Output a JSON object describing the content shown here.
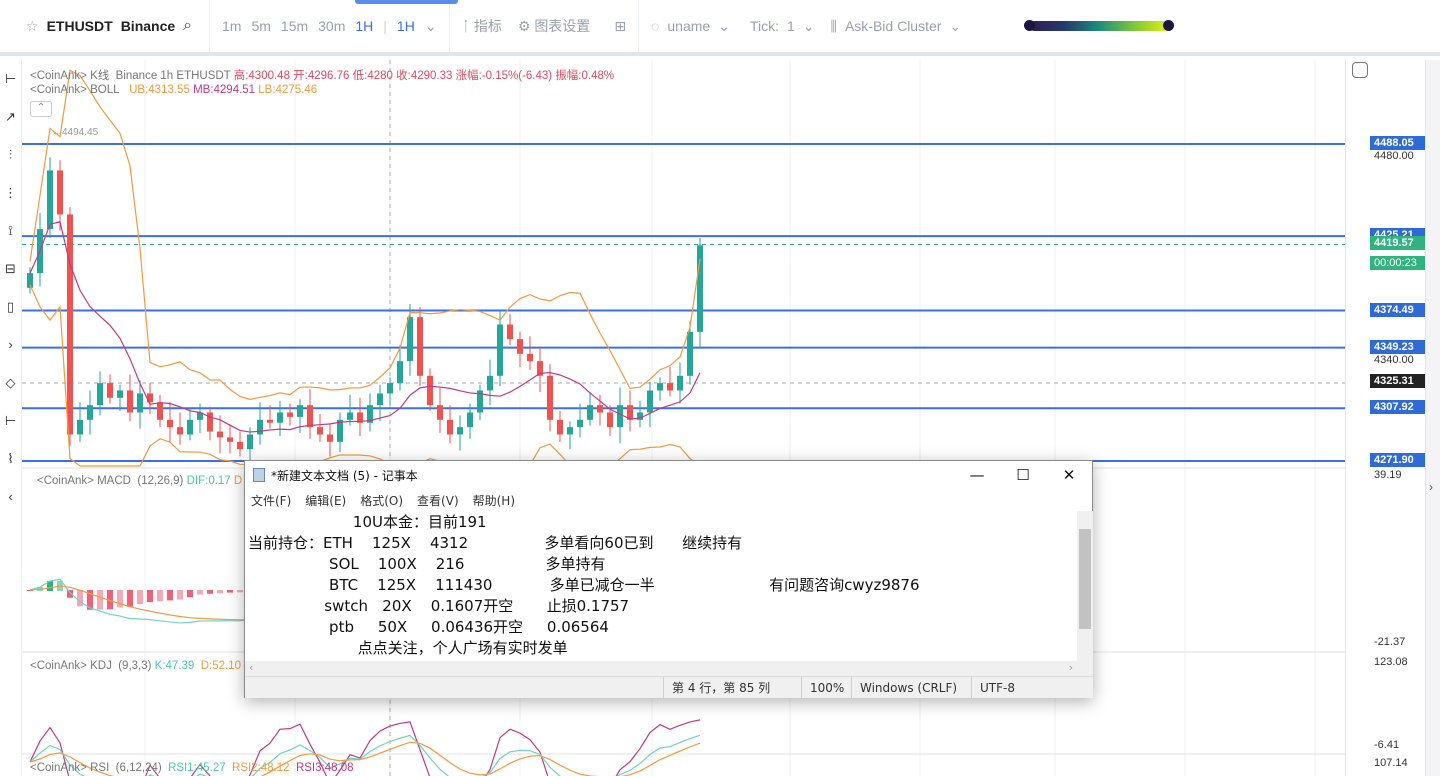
{
  "toolbar": {
    "symbol": "ETHUSDT",
    "exchange": "Binance",
    "timeframes": [
      "1m",
      "5m",
      "15m",
      "30m",
      "1H"
    ],
    "selected_tf": "1H",
    "indicators": "指标",
    "chart_settings": "图表设置",
    "user": "uname",
    "tick_label": "Tick:",
    "tick_value": "1",
    "cluster": "Ask-Bid Cluster"
  },
  "legend": {
    "kline": {
      "prefix": "<CoinAnk> K线",
      "info": "Binance 1h ETHUSDT",
      "high": "高:4300.48",
      "open": "开:4296.76",
      "low": "低:4280",
      "close": "收:4290.33",
      "change": "涨幅:-0.15%(-6.43)",
      "amp": "振幅:0.48%"
    },
    "boll": {
      "prefix": "<CoinAnk> BOLL",
      "ub": "UB:4313.55",
      "mb": "MB:4294.51",
      "lb": "LB:4275.46"
    },
    "macd": {
      "prefix": "<CoinAnk> MACD",
      "params": "(12,26,9)",
      "dif": "DIF:0.17",
      "dea": "D"
    },
    "kdj": {
      "prefix": "<CoinAnk> KDJ",
      "params": "(9,3,3)",
      "k": "K:47.39",
      "d": "D:52.10"
    },
    "rsi": {
      "prefix": "<CoinAnk> RSI",
      "params": "(6,12,24)",
      "r1": "RSI1:45.27",
      "r2": "RSI2:48.12",
      "r3": "RSI3:48.08"
    }
  },
  "max_label": "4494.45",
  "price_lines": [
    {
      "price": 4488.05,
      "label": "4488.05"
    },
    {
      "price": 4425.21,
      "label": "4425.21"
    },
    {
      "price": 4374.49,
      "label": "4374.49"
    },
    {
      "price": 4349.23,
      "label": "4349.23"
    },
    {
      "price": 4307.92,
      "label": "4307.92"
    },
    {
      "price": 4271.9,
      "label": "4271.90"
    }
  ],
  "axis_ticks": {
    "t4480": "4480.00",
    "t4340": "4340.00",
    "macd_top": "39.19",
    "macd_bot": "-21.37",
    "kdj_top": "123.08",
    "kdj_bot": "-6.41",
    "rsi_top": "107.14"
  },
  "current_price": "4419.57",
  "countdown": "00:00:23",
  "crosshair_price": "4325.31",
  "colors": {
    "up": "#26a69a",
    "down": "#ef5350",
    "line": "#3a6fe8",
    "boll_ub": "#f29a3f",
    "boll_mb": "#c2398a"
  },
  "candles": [
    4400,
    4430,
    4470,
    4440,
    4290,
    4300,
    4310,
    4325,
    4315,
    4320,
    4305,
    4318,
    4312,
    4300,
    4295,
    4290,
    4300,
    4305,
    4292,
    4288,
    4285,
    4280,
    4290,
    4300,
    4298,
    4305,
    4302,
    4310,
    4295,
    4290,
    4285,
    4300,
    4305,
    4298,
    4310,
    4318,
    4325,
    4340,
    4370,
    4330,
    4310,
    4300,
    4290,
    4295,
    4305,
    4320,
    4330,
    4365,
    4355,
    4345,
    4340,
    4330,
    4300,
    4290,
    4295,
    4300,
    4310,
    4305,
    4295,
    4310,
    4300,
    4305,
    4320,
    4325,
    4320,
    4330,
    4360,
    4419
  ],
  "notepad": {
    "title": "*新建文本文档 (5) - 记事本",
    "menu": [
      "文件(F)",
      "编辑(E)",
      "格式(O)",
      "查看(V)",
      "帮助(H)"
    ],
    "lines": [
      "                      10U本金：目前191",
      "当前持仓：ETH    125X    4312                多单看向60已到      继续持有",
      "                 SOL    100X    216                 多单持有",
      "                 BTC    125X    111430            多单已减仓一半                        有问题咨询cwyz9876",
      "                swtch   20X    0.1607开空       止损0.1757",
      "                 ptb     50X     0.06436开空     0.06564",
      "                       点点关注，个人广场有实时发单"
    ],
    "status": {
      "pos": "第 4 行，第 85 列",
      "zoom": "100%",
      "eol": "Windows (CRLF)",
      "enc": "UTF-8"
    }
  }
}
